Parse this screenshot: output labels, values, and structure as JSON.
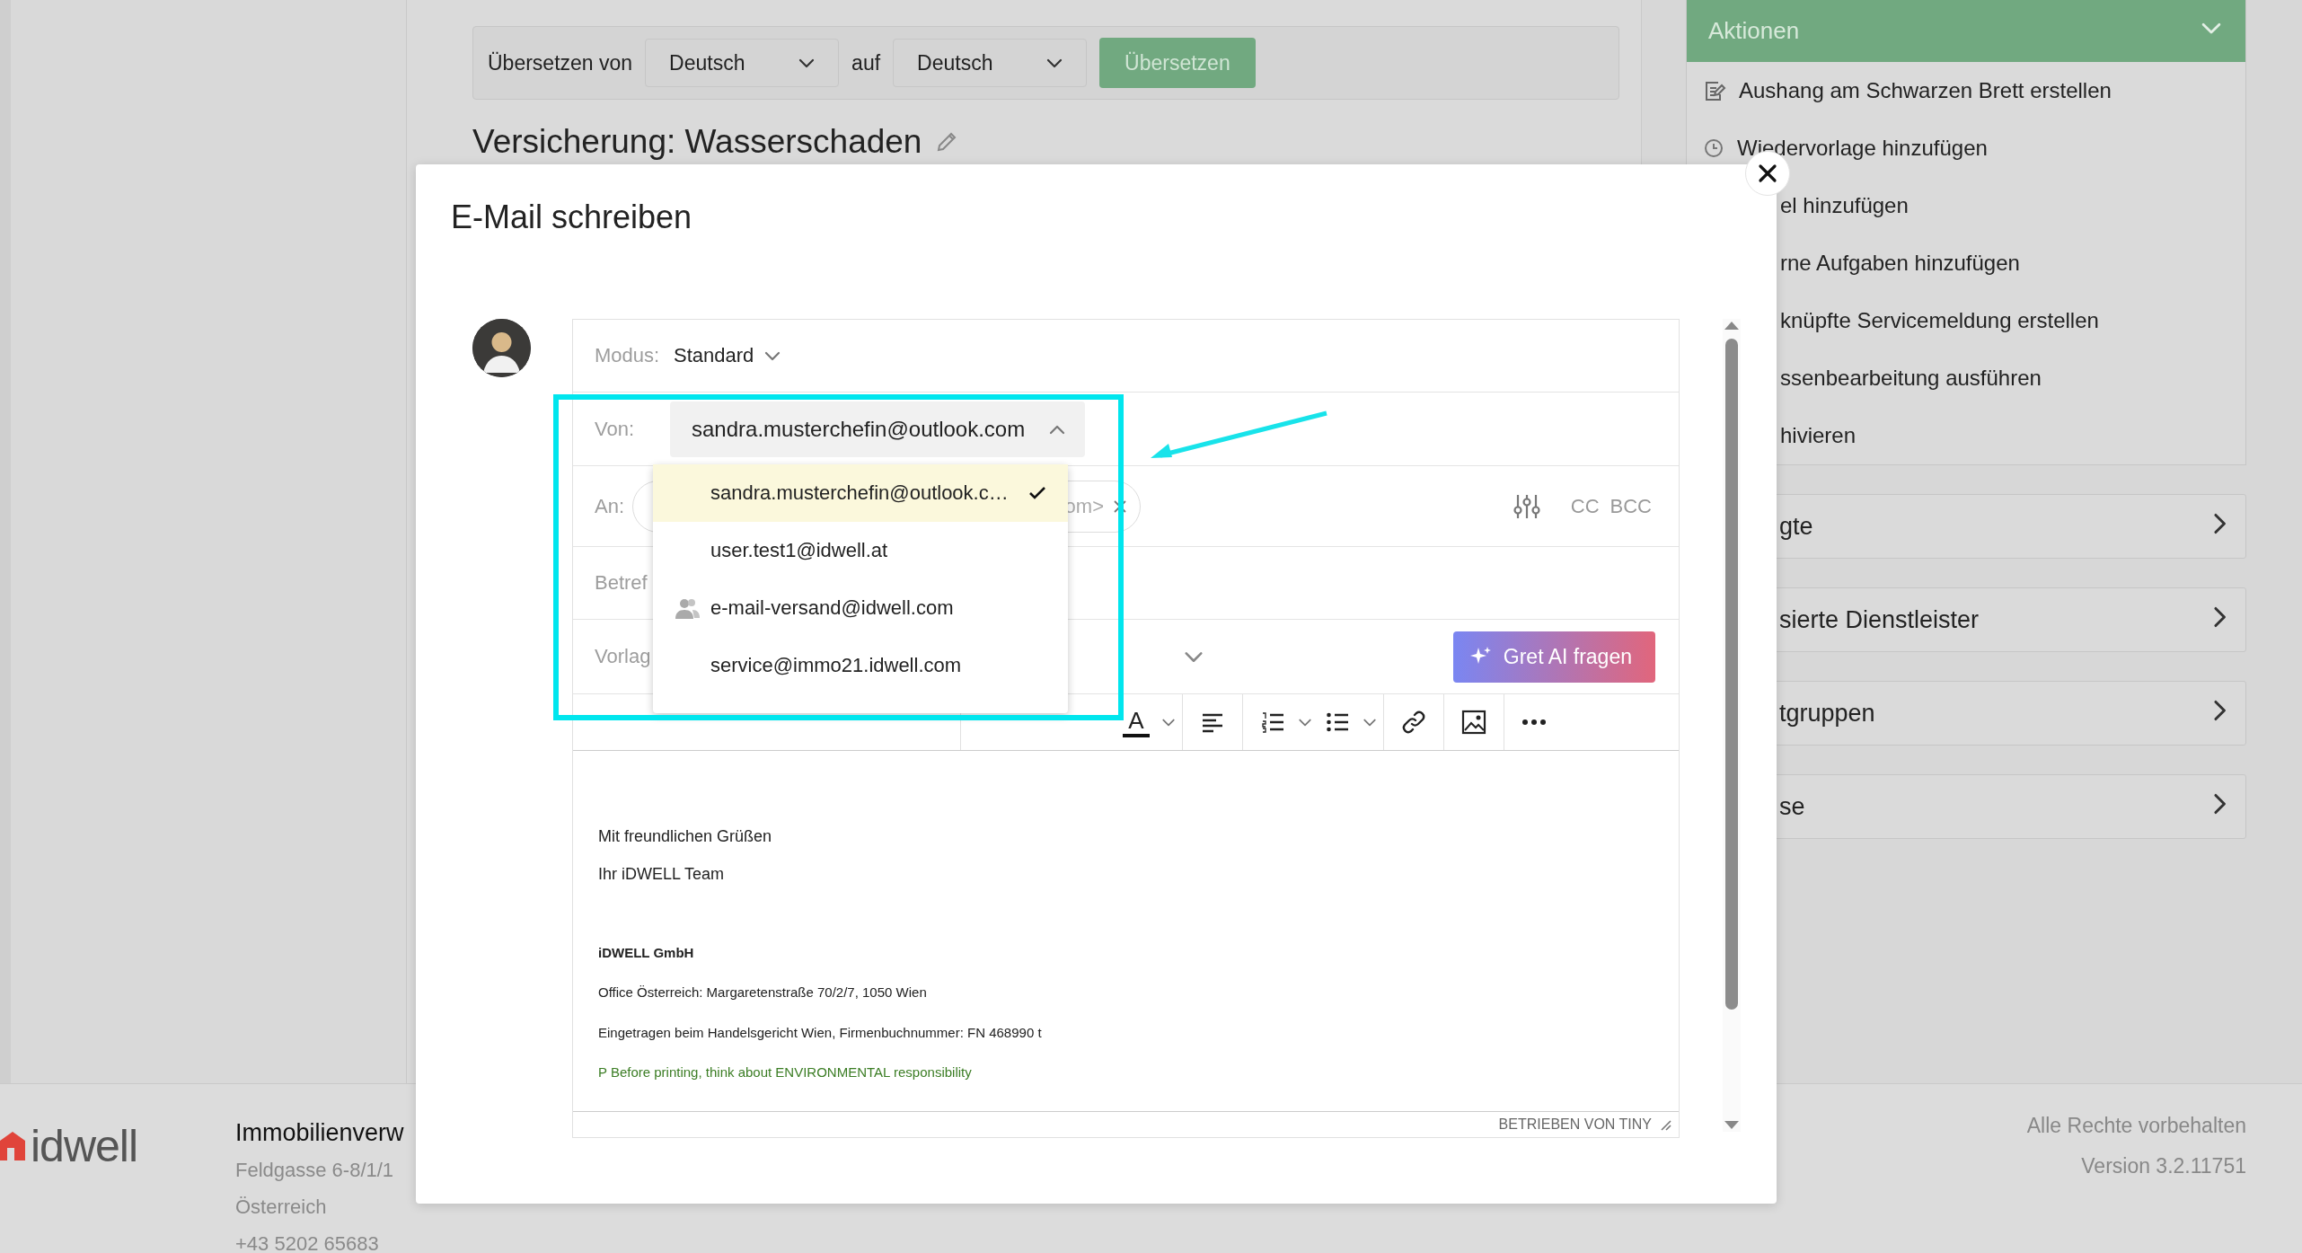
{
  "translate_bar": {
    "label": "Übersetzen von",
    "from": "Deutsch",
    "connector": "auf",
    "to": "Deutsch",
    "button": "Übersetzen"
  },
  "page_title": "Versicherung: Wasserschaden",
  "actions_panel": {
    "title": "Aktionen",
    "expanded": true,
    "items": [
      {
        "kind": "note",
        "label": "Aushang am Schwarzen Brett erstellen"
      },
      {
        "kind": "clock",
        "label": "Wiedervorlage hinzufügen"
      },
      {
        "kind": "clipped",
        "label": "el hinzufügen"
      },
      {
        "kind": "clipped",
        "label": "rne Aufgaben hinzufügen"
      },
      {
        "kind": "clipped",
        "label": "knüpfte Servicemeldung erstellen"
      },
      {
        "kind": "clipped",
        "label": "ssenbearbeitung ausführen"
      },
      {
        "kind": "clipped",
        "label": "hivieren"
      }
    ]
  },
  "collapsed_panels": [
    {
      "label": "gte",
      "expanded": false
    },
    {
      "label": "sierte Dienstleister",
      "expanded": false
    },
    {
      "label": "tgruppen",
      "expanded": false
    },
    {
      "label": "se",
      "expanded": false
    }
  ],
  "footer": {
    "brand": "idwell",
    "address": [
      "Immobilienverw",
      "Feldgasse 6-8/1/1",
      "Österreich",
      "+43 5202 65683"
    ],
    "rights": "Alle Rechte vorbehalten",
    "version": "Version 3.2.11751"
  },
  "dialog": {
    "title": "E-Mail schreiben",
    "mode": {
      "label": "Modus:",
      "value": "Standard"
    },
    "from": {
      "label": "Von:",
      "value": "sandra.musterchefin@outlook.com",
      "expanded": true,
      "options": [
        {
          "label": "sandra.musterchefin@outlook.c…",
          "selected": true,
          "kind": "address"
        },
        {
          "label": "user.test1@idwell.at",
          "selected": false,
          "kind": "address"
        },
        {
          "label": "e-mail-versand@idwell.com",
          "selected": false,
          "kind": "group"
        },
        {
          "label": "service@immo21.idwell.com",
          "selected": false,
          "kind": "address"
        }
      ]
    },
    "to": {
      "label": "An:",
      "recipient": "om>",
      "cc": "CC",
      "bcc": "BCC"
    },
    "subject": {
      "label": "Betref"
    },
    "template": {
      "label": "Vorlag"
    },
    "ai_button": "Gret AI fragen",
    "toolbar": {
      "format": [
        {
          "kind": "color",
          "label": "A"
        }
      ]
    },
    "body": [
      {
        "kind": "text",
        "text": "Mit freundlichen Grüßen"
      },
      {
        "kind": "text",
        "text": "Ihr iDWELL Team"
      },
      {
        "kind": "heading",
        "text": "iDWELL GmbH"
      },
      {
        "kind": "small",
        "text": "Office Österreich: Margaretenstraße 70/2/7, 1050 Wien"
      },
      {
        "kind": "small",
        "text": "Eingetragen beim Handelsgericht Wien, Firmenbuchnummer: FN 468990 t"
      },
      {
        "kind": "note",
        "text": "P Before printing, think about ENVIRONMENTAL responsibility"
      }
    ],
    "status": "BETRIEBEN VON TINY"
  }
}
